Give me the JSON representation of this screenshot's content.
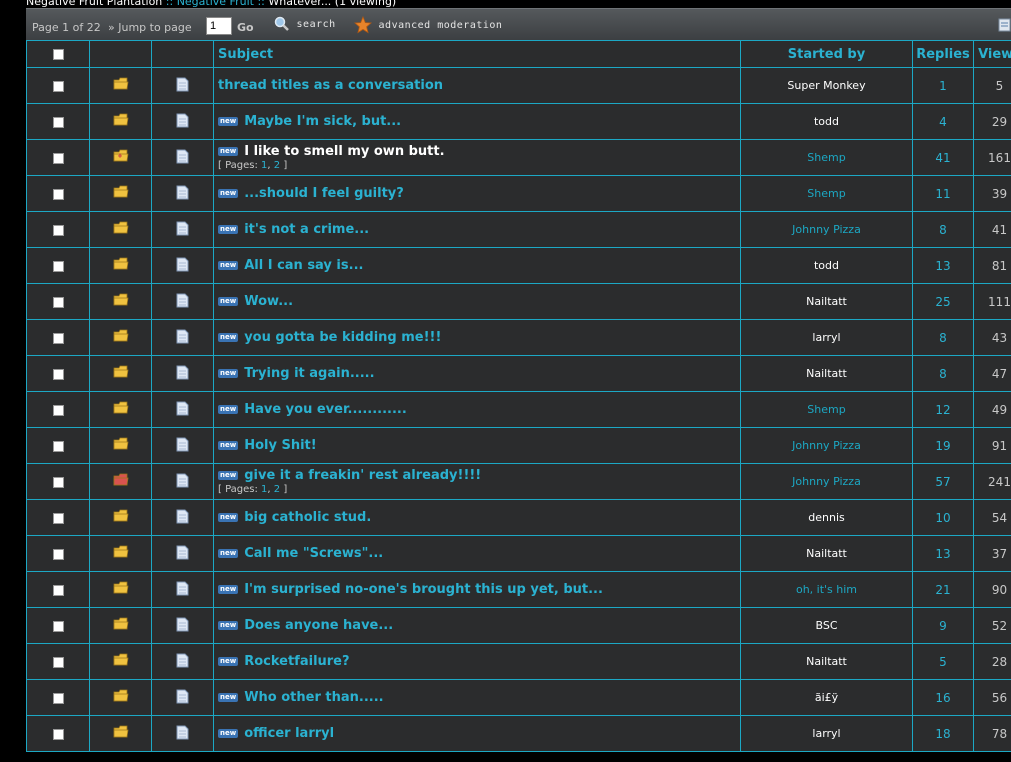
{
  "breadcrumb": {
    "part1": "Negative Fruit Plantation",
    "sep1": " :: ",
    "part2": "Negative Fruit",
    "sep2": " :: ",
    "part3": "Whatever... (1 viewing)"
  },
  "toolbar": {
    "page_info": "Page 1 of 22",
    "jump_label": "» Jump to page",
    "jump_value": "1",
    "go_label": "Go",
    "search_label": "search",
    "advanced_label": "advanced moderation"
  },
  "columns": {
    "subject": "Subject",
    "started_by": "Started by",
    "replies": "Replies",
    "views": "Views"
  },
  "threads": [
    {
      "title": "thread titles as a conversation",
      "new": false,
      "author": "Super Monkey",
      "author_link": false,
      "replies": "1",
      "views": "5",
      "icon": "folder",
      "pages": null
    },
    {
      "title": "Maybe I'm sick, but...",
      "new": true,
      "author": "todd",
      "author_link": false,
      "replies": "4",
      "views": "29",
      "icon": "folder",
      "pages": null
    },
    {
      "title": "I like to smell my own butt.",
      "new": true,
      "white": true,
      "author": "Shemp",
      "author_link": true,
      "replies": "41",
      "views": "161",
      "icon": "folder-hot",
      "pages": [
        "1",
        "2"
      ]
    },
    {
      "title": "...should I feel guilty?",
      "new": true,
      "author": "Shemp",
      "author_link": true,
      "replies": "11",
      "views": "39",
      "icon": "folder",
      "pages": null
    },
    {
      "title": "it's not a crime...",
      "new": true,
      "author": "Johnny Pizza",
      "author_link": true,
      "replies": "8",
      "views": "41",
      "icon": "folder",
      "pages": null
    },
    {
      "title": "All I can say is...",
      "new": true,
      "author": "todd",
      "author_link": false,
      "replies": "13",
      "views": "81",
      "icon": "folder",
      "pages": null
    },
    {
      "title": "Wow...",
      "new": true,
      "author": "Nailtatt",
      "author_link": false,
      "replies": "25",
      "views": "111",
      "icon": "folder",
      "pages": null
    },
    {
      "title": "you gotta be kidding me!!!",
      "new": true,
      "author": "larryl",
      "author_link": false,
      "replies": "8",
      "views": "43",
      "icon": "folder",
      "pages": null
    },
    {
      "title": "Trying it again.....",
      "new": true,
      "author": "Nailtatt",
      "author_link": false,
      "replies": "8",
      "views": "47",
      "icon": "folder",
      "pages": null
    },
    {
      "title": "Have you ever............",
      "new": true,
      "author": "Shemp",
      "author_link": true,
      "replies": "12",
      "views": "49",
      "icon": "folder",
      "pages": null
    },
    {
      "title": "Holy Shit!",
      "new": true,
      "author": "Johnny Pizza",
      "author_link": true,
      "replies": "19",
      "views": "91",
      "icon": "folder",
      "pages": null
    },
    {
      "title": "give it a freakin' rest already!!!!",
      "new": true,
      "author": "Johnny Pizza",
      "author_link": true,
      "replies": "57",
      "views": "241",
      "icon": "folder-red",
      "pages": [
        "1",
        "2"
      ]
    },
    {
      "title": "big catholic stud.",
      "new": true,
      "author": "dennis",
      "author_link": false,
      "replies": "10",
      "views": "54",
      "icon": "folder",
      "pages": null
    },
    {
      "title": "Call me \"Screws\"...",
      "new": true,
      "author": "Nailtatt",
      "author_link": false,
      "replies": "13",
      "views": "37",
      "icon": "folder",
      "pages": null
    },
    {
      "title": "I'm surprised no-one's brought this up yet, but...",
      "new": true,
      "author": "oh, it's him",
      "author_link": true,
      "replies": "21",
      "views": "90",
      "icon": "folder",
      "pages": null
    },
    {
      "title": "Does anyone have...",
      "new": true,
      "author": "BSC",
      "author_link": false,
      "replies": "9",
      "views": "52",
      "icon": "folder",
      "pages": null
    },
    {
      "title": "Rocketfailure?",
      "new": true,
      "author": "Nailtatt",
      "author_link": false,
      "replies": "5",
      "views": "28",
      "icon": "folder",
      "pages": null
    },
    {
      "title": "Who other than.....",
      "new": true,
      "author": "ãi£ÿ",
      "author_link": false,
      "replies": "16",
      "views": "56",
      "icon": "folder",
      "pages": null
    },
    {
      "title": "officer larryl",
      "new": true,
      "author": "larryl",
      "author_link": false,
      "replies": "18",
      "views": "78",
      "icon": "folder",
      "pages": null
    }
  ],
  "labels": {
    "new_badge": "new",
    "pages_prefix": "[ Pages: ",
    "pages_sep": ", ",
    "pages_suffix": " ]"
  },
  "colors": {
    "accent": "#2bb2d1",
    "row_bg": "#2b2c2d",
    "border": "#1ca8c4",
    "folder": "#f0c240",
    "folder_red": "#d9534f"
  }
}
